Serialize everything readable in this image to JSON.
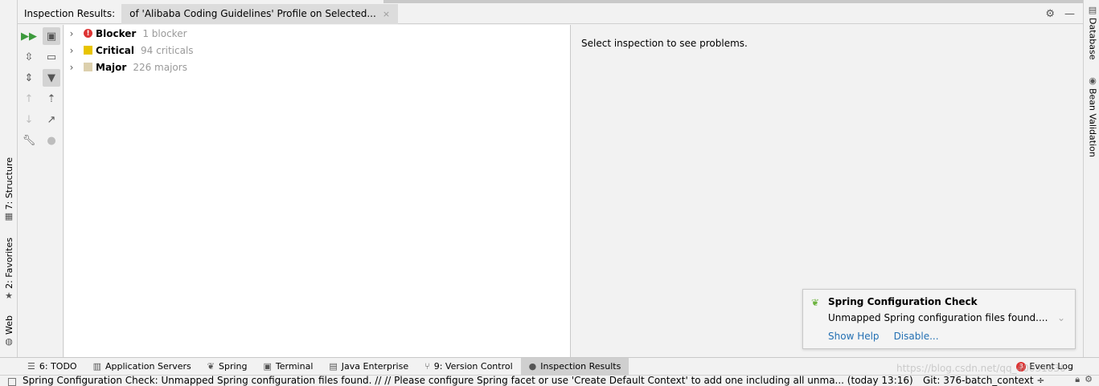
{
  "header": {
    "title": "Inspection Results:",
    "tab_label": "of 'Alibaba Coding Guidelines' Profile on Selected...",
    "close_glyph": "×"
  },
  "left_strip": {
    "structure": "7: Structure",
    "favorites": "2: Favorites",
    "web": "Web"
  },
  "right_strip": {
    "database": "Database",
    "bean_validation": "Bean Validation"
  },
  "tree": {
    "rows": [
      {
        "name": "Blocker",
        "count": "1 blocker",
        "severity": "blocker",
        "color": "#d33333"
      },
      {
        "name": "Critical",
        "count": "94 criticals",
        "severity": "critical",
        "color": "#e8c400"
      },
      {
        "name": "Major",
        "count": "226 majors",
        "severity": "major",
        "color": "#dcd0ad"
      }
    ]
  },
  "detail": {
    "message": "Select inspection to see problems."
  },
  "notification": {
    "title": "Spring Configuration Check",
    "body": "Unmapped Spring configuration files found....",
    "show_help": "Show Help",
    "disable": "Disable..."
  },
  "bottom_tabs": [
    {
      "label": "6: TODO",
      "icon": "todo-icon"
    },
    {
      "label": "Application Servers",
      "icon": "servers-icon"
    },
    {
      "label": "Spring",
      "icon": "spring-icon"
    },
    {
      "label": "Terminal",
      "icon": "terminal-icon"
    },
    {
      "label": "Java Enterprise",
      "icon": "java-enterprise-icon"
    },
    {
      "label": "9: Version Control",
      "icon": "version-control-icon"
    },
    {
      "label": "Inspection Results",
      "icon": "inspection-icon",
      "active": true
    }
  ],
  "event_log": {
    "label": "Event Log",
    "badge": "3"
  },
  "status": {
    "message": "Spring Configuration Check: Unmapped Spring configuration files found. // // Please configure Spring facet or use 'Create Default Context' to add one including all unma... (today 13:16)",
    "git_branch": "Git: 376-batch_context ÷"
  },
  "watermark": "https://blog.csdn.net/qq_40031836",
  "colors": {
    "accent_link": "#2470b3",
    "run_green": "#3c9a3c",
    "spring_leaf": "#6db33f"
  }
}
